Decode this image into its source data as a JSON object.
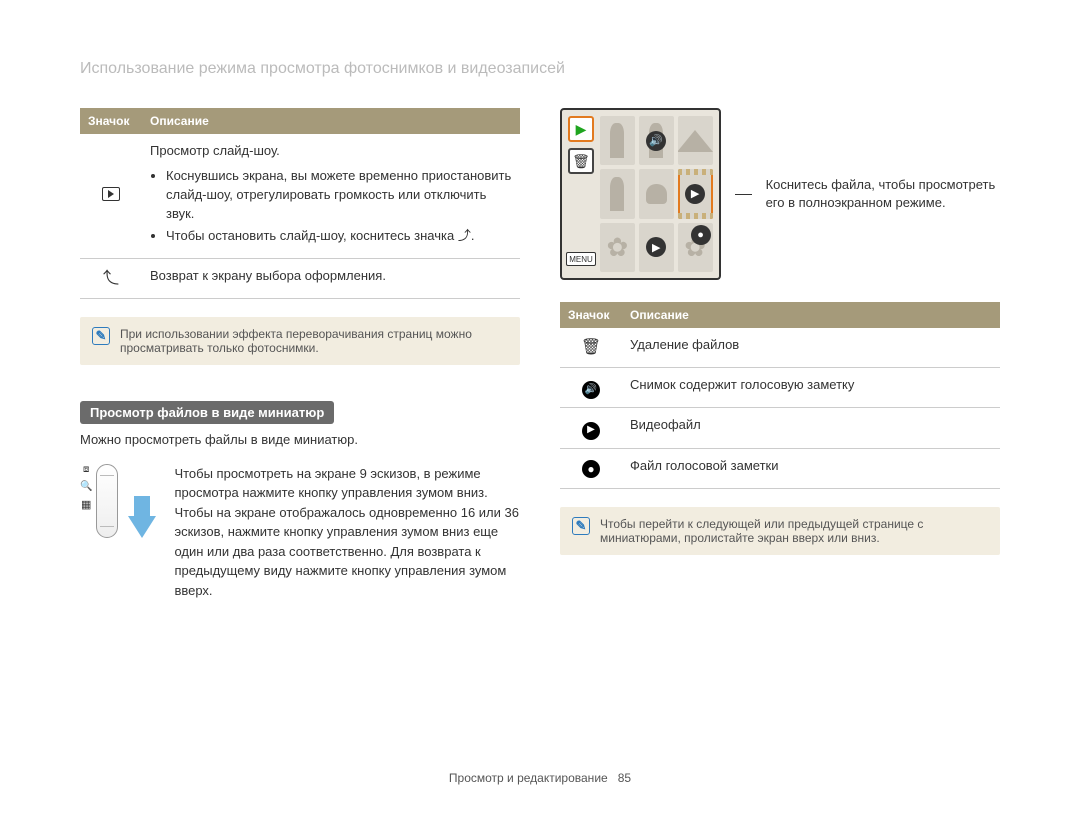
{
  "page_title": "Использование режима просмотра фотоснимков и видеозаписей",
  "left_table": {
    "headers": {
      "icon": "Значок",
      "desc": "Описание"
    },
    "rows": [
      {
        "icon_name": "slideshow-icon",
        "headline": "Просмотр слайд-шоу.",
        "bullets": [
          "Коснувшись экрана, вы можете временно приостановить слайд-шоу, отрегулировать громкость или отключить звук.",
          "Чтобы остановить слайд-шоу, коснитесь значка ⤴."
        ]
      },
      {
        "icon_name": "back-icon",
        "desc": "Возврат к экрану выбора оформления."
      }
    ]
  },
  "left_note": "При использовании эффекта переворачивания страниц можно просматривать только фотоснимки.",
  "thumb_section": {
    "heading": "Просмотр файлов в виде миниатюр",
    "intro": "Можно просмотреть файлы в виде миниатюр.",
    "howto": "Чтобы просмотреть на экране 9 эскизов, в режиме просмотра нажмите кнопку управления зумом вниз. Чтобы на экране отображалось одновременно 16 или 36 эскизов, нажмите кнопку управления зумом вниз еще один или два раза соответственно. Для возврата к предыдущему виду нажмите кнопку управления зумом вверх."
  },
  "right_screenshot": {
    "strip_play_label": "▶",
    "strip_del_label": "🗑",
    "menu_label": "MENU"
  },
  "callout": "Коснитесь файла, чтобы просмотреть его в полноэкранном режиме.",
  "right_table": {
    "headers": {
      "icon": "Значок",
      "desc": "Описание"
    },
    "rows": [
      {
        "icon_name": "trash-icon",
        "desc": "Удаление файлов"
      },
      {
        "icon_name": "speaker-icon",
        "desc": "Снимок содержит голосовую заметку"
      },
      {
        "icon_name": "play-icon",
        "desc": "Видеофайл"
      },
      {
        "icon_name": "mic-icon",
        "desc": "Файл голосовой заметки"
      }
    ]
  },
  "right_note": "Чтобы перейти к следующей или предыдущей странице с миниатюрами, пролистайте экран вверх или вниз.",
  "footer": {
    "chapter": "Просмотр и редактирование",
    "page": "85"
  }
}
